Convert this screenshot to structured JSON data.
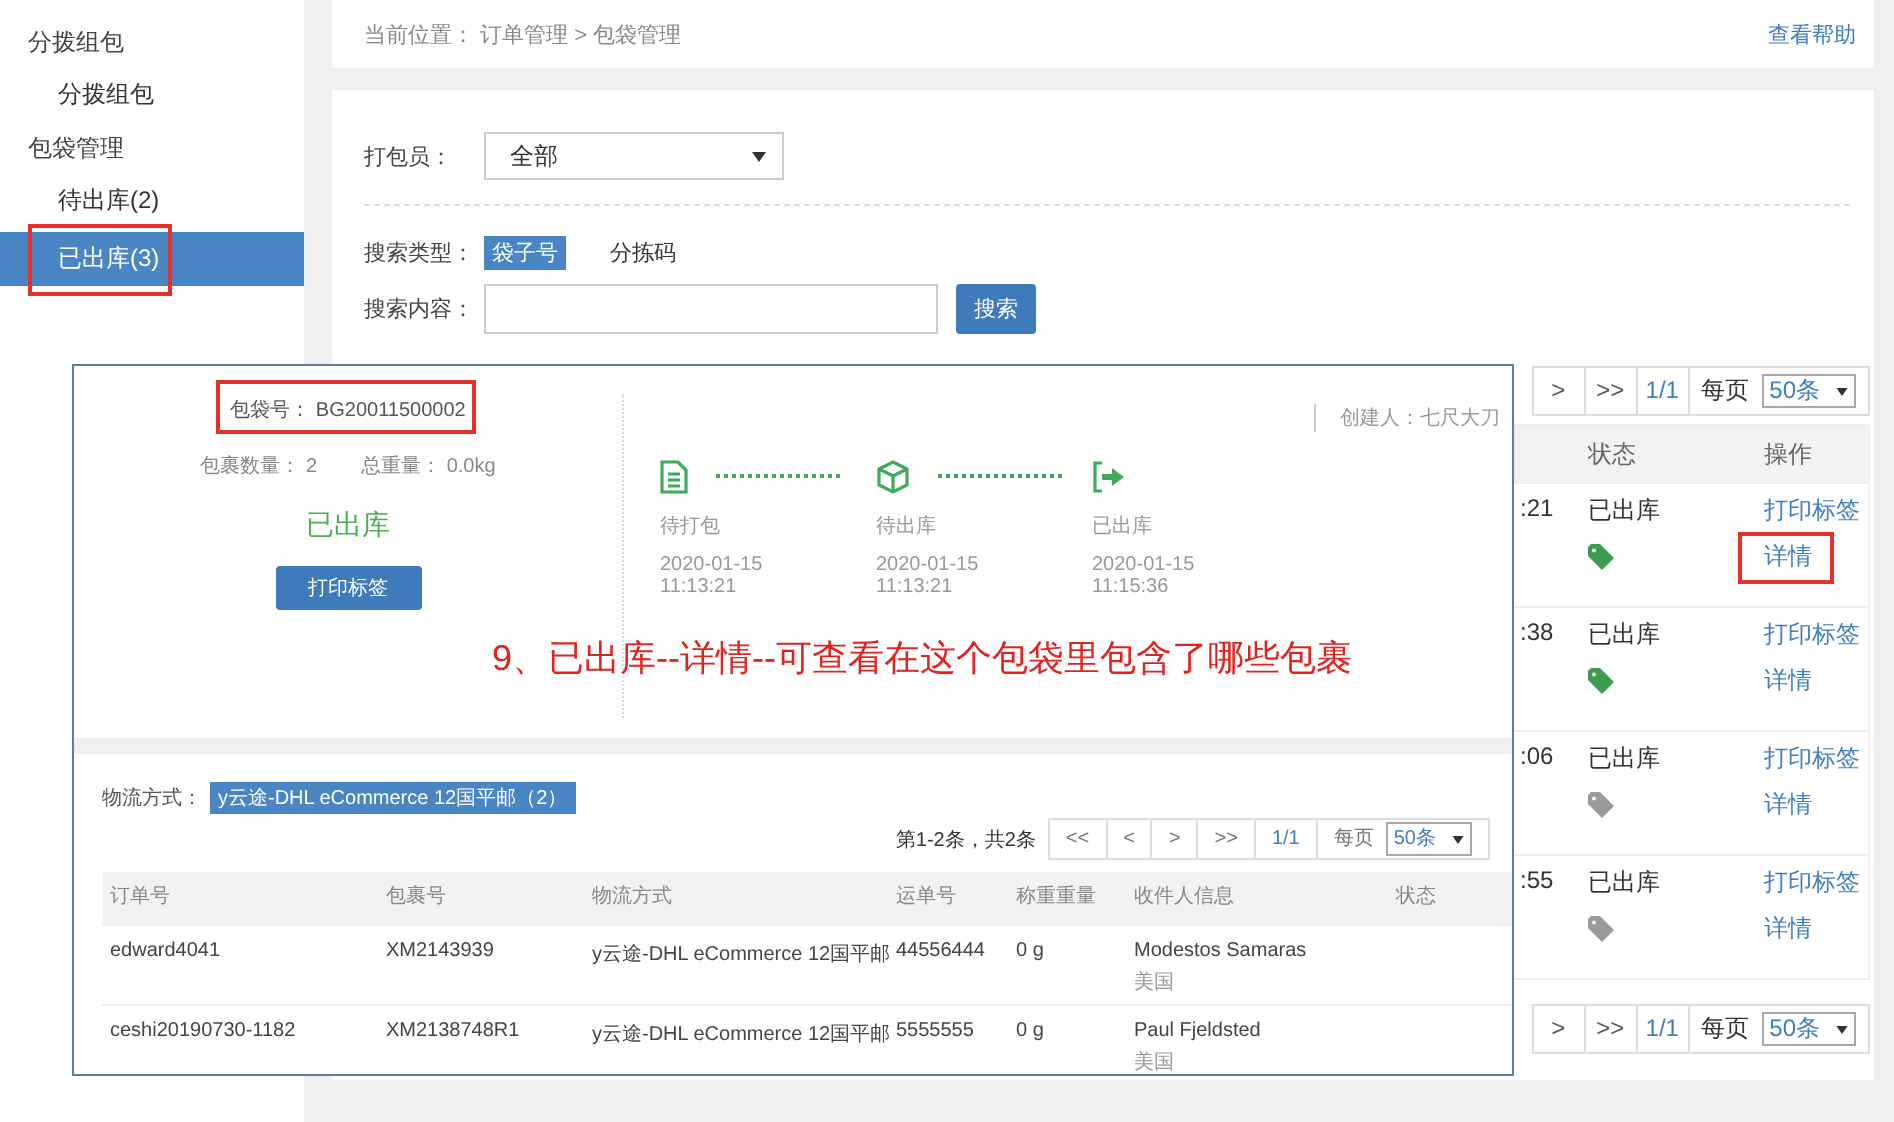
{
  "sidebar": {
    "items": [
      {
        "label": "分拨组包",
        "children": [
          {
            "label": "分拨组包",
            "selected": false
          }
        ]
      },
      {
        "label": "包袋管理",
        "children": [
          {
            "label": "待出库(2)",
            "selected": false
          },
          {
            "label": "已出库(3)",
            "selected": true
          }
        ]
      }
    ]
  },
  "breadcrumb": "当前位置： 订单管理 > 包袋管理",
  "help_link": "查看帮助",
  "filters": {
    "packer_label": "打包员：",
    "packer_value": "全部",
    "search_type_label": "搜索类型：",
    "search_types": [
      {
        "label": "袋子号",
        "selected": true
      },
      {
        "label": "分拣码",
        "selected": false
      }
    ],
    "search_content_label": "搜索内容：",
    "search_button": "搜索"
  },
  "table": {
    "pagination_top": [
      ">",
      ">>",
      "1/1"
    ],
    "per_page_label": "每页",
    "per_page": "50条",
    "columns": [
      "状态",
      "操作"
    ],
    "rows": [
      {
        "time": ":21",
        "status": "已出库",
        "color": "#3c9b4e",
        "actions": [
          "打印标签",
          "详情"
        ]
      },
      {
        "time": ":38",
        "status": "已出库",
        "color": "#3c9b4e",
        "actions": [
          "打印标签",
          "详情"
        ]
      },
      {
        "time": ":06",
        "status": "已出库",
        "color": "#9a9a9a",
        "actions": [
          "打印标签",
          "详情"
        ]
      },
      {
        "time": ":55",
        "status": "已出库",
        "color": "#9a9a9a",
        "actions": [
          "打印标签",
          "详情"
        ]
      }
    ],
    "pagination_bottom": [
      ">",
      ">>",
      "1/1"
    ],
    "per_page_label_bottom": "每页",
    "per_page_bottom": "50条"
  },
  "detail": {
    "bag_no": "包袋号：  BG20011500002",
    "count": "包裹数量：  2",
    "weight": "总重量：  0.0kg",
    "status": "已出库",
    "print_button": "打印标签",
    "creator": "创建人：七尺大刀",
    "steps": [
      {
        "kind": "document",
        "label": "待打包",
        "date": "2020-01-15",
        "time": "11:13:21"
      },
      {
        "kind": "cube",
        "label": "待出库",
        "date": "2020-01-15",
        "time": "11:13:21"
      },
      {
        "kind": "exit",
        "label": "已出库",
        "date": "2020-01-15",
        "time": "11:15:36"
      }
    ],
    "shipping_label": "物流方式：",
    "shipping_tag": "y云途-DHL eCommerce 12国平邮（2）",
    "summary": "第1-2条，共2条",
    "pagination": [
      "<<",
      "<",
      ">",
      ">>",
      "1/1"
    ],
    "per_page_label": "每页",
    "per_page": "50条",
    "columns": [
      "订单号",
      "包裹号",
      "物流方式",
      "运单号",
      "称重重量",
      "收件人信息",
      "状态"
    ],
    "rows": [
      {
        "cells": [
          "edward4041",
          "XM2143939",
          "y云途-DHL eCommerce 12国平邮",
          "44556444",
          "0 g",
          "Modestos Samaras"
        ],
        "country": "美国"
      },
      {
        "cells": [
          "ceshi20190730-1182",
          "XM2138748R1",
          "y云途-DHL eCommerce 12国平邮",
          "5555555",
          "0 g",
          "Paul Fjeldsted"
        ],
        "country": "美国"
      }
    ]
  },
  "caption": "9、已出库--详情--可查看在这个包袋里包含了哪些包裹"
}
